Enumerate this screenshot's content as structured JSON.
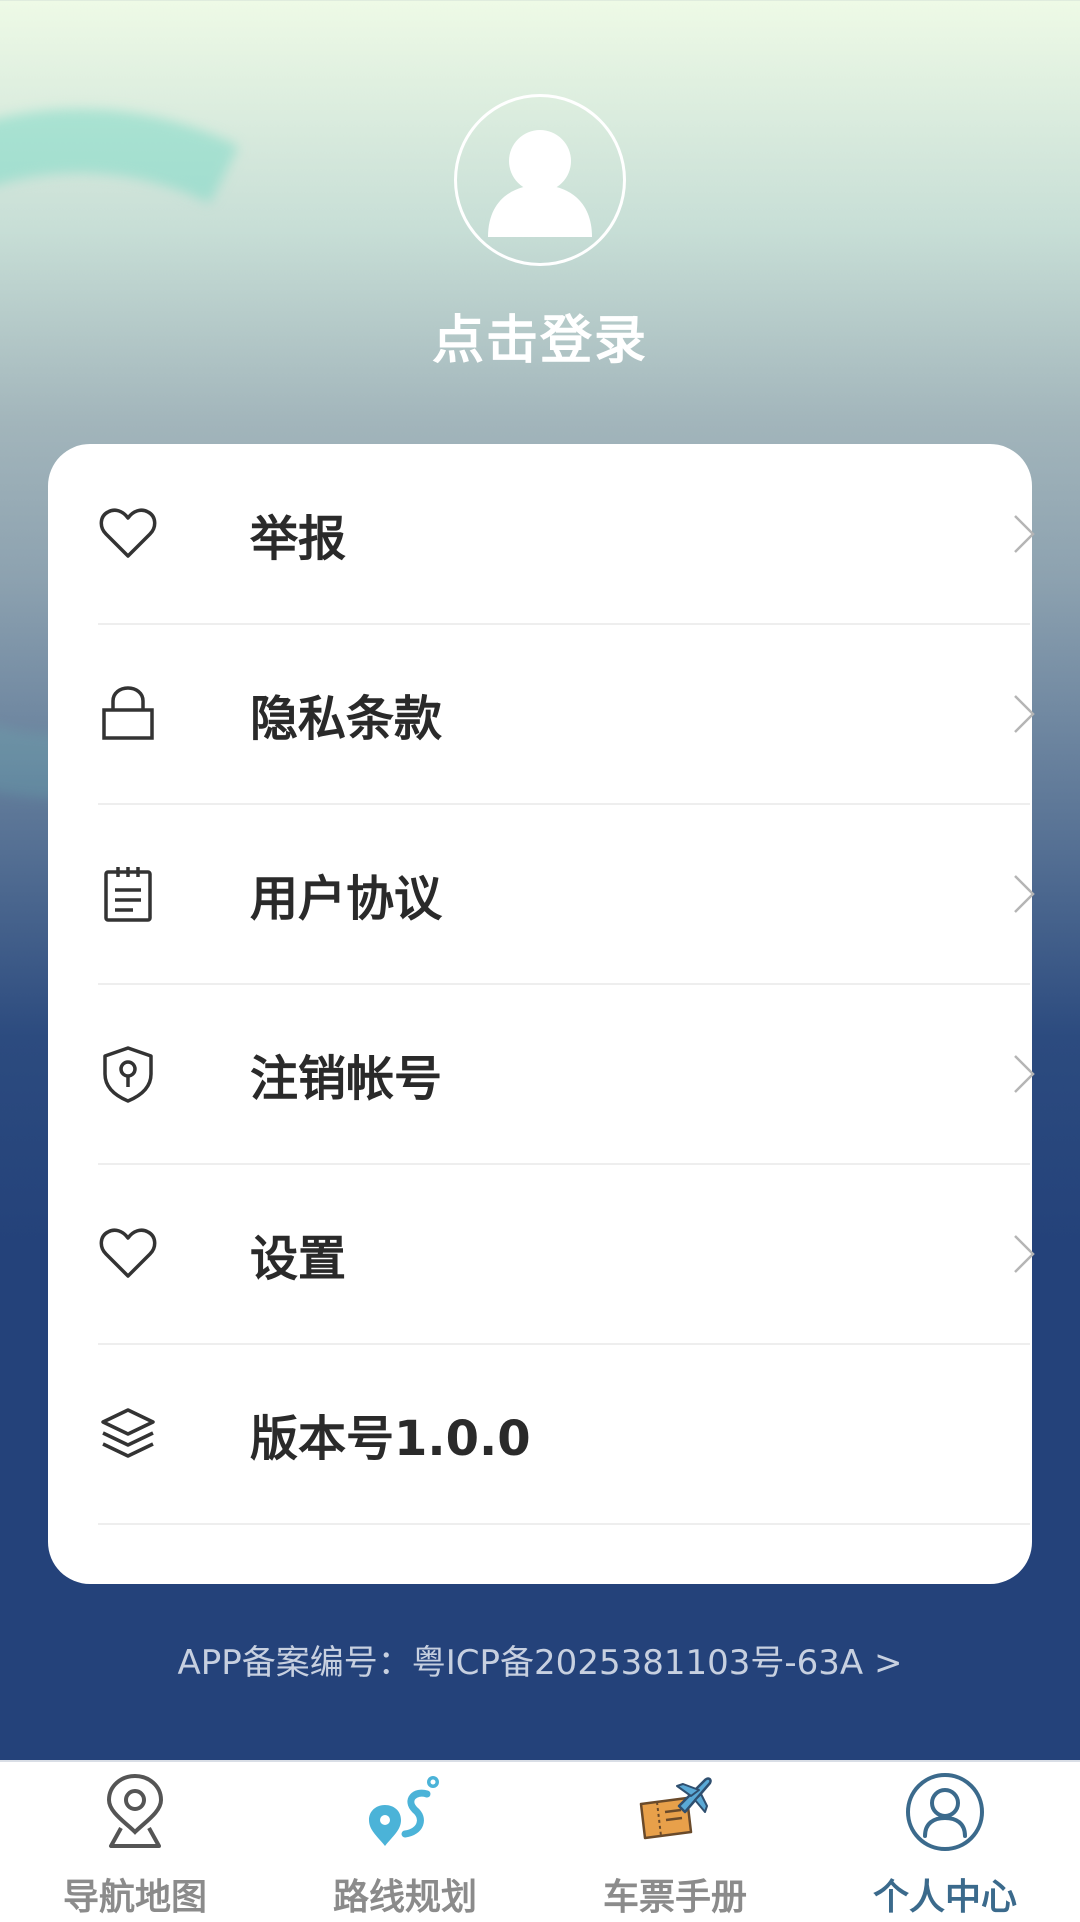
{
  "profile": {
    "avatar_icon": "user-avatar-icon",
    "login_label": "点击登录"
  },
  "menu": {
    "items": [
      {
        "label": "举报",
        "icon": "heart-icon",
        "has_chevron": true
      },
      {
        "label": "隐私条款",
        "icon": "lock-icon",
        "has_chevron": true
      },
      {
        "label": "用户协议",
        "icon": "notepad-icon",
        "has_chevron": true
      },
      {
        "label": "注销帐号",
        "icon": "shield-keyhole-icon",
        "has_chevron": true
      },
      {
        "label": "设置",
        "icon": "heart-icon",
        "has_chevron": true
      },
      {
        "label": "版本号1.0.0",
        "icon": "layers-icon",
        "has_chevron": false
      }
    ]
  },
  "footer": {
    "icp_text": "APP备案编号：粤ICP备2025381103号-63A >"
  },
  "tabbar": {
    "tabs": [
      {
        "label": "导航地图",
        "icon": "map-pin-icon",
        "active": false
      },
      {
        "label": "路线规划",
        "icon": "route-icon",
        "active": false
      },
      {
        "label": "车票手册",
        "icon": "ticket-plane-icon",
        "active": false
      },
      {
        "label": "个人中心",
        "icon": "user-circle-icon",
        "active": true
      }
    ]
  },
  "colors": {
    "active_tab": "#3b6a8c",
    "inactive_tab": "#8b8b8b",
    "bg_top": "#eefae6",
    "bg_bottom": "#24427a"
  }
}
